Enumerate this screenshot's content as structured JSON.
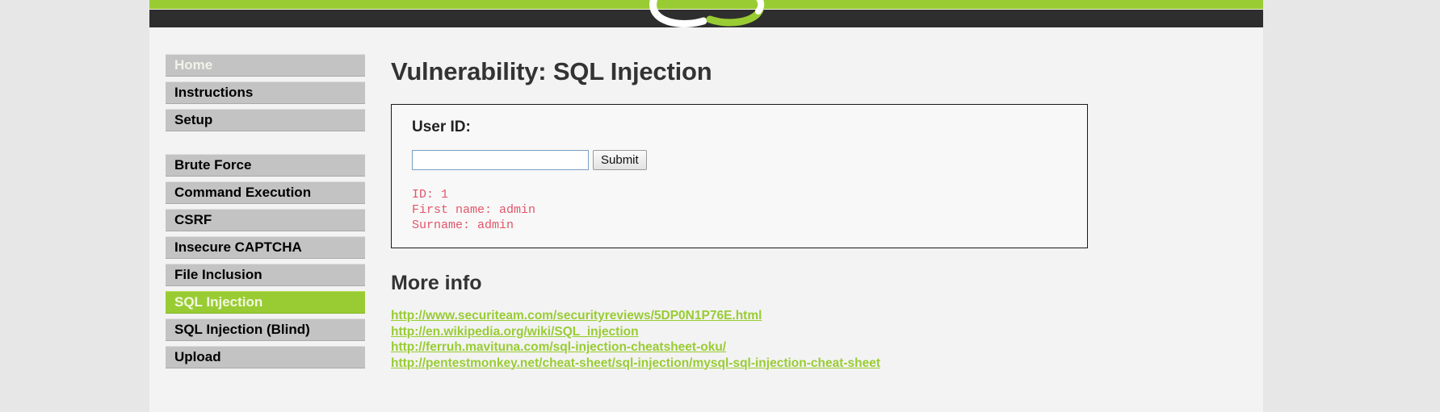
{
  "header": {
    "logo_name": "dvwa-logo",
    "bar_color": "#99cc33",
    "background_color": "#2e2e2e"
  },
  "sidebar": {
    "groups": [
      {
        "items": [
          {
            "label": "Home",
            "state": "dim"
          },
          {
            "label": "Instructions",
            "state": "normal"
          },
          {
            "label": "Setup",
            "state": "normal"
          }
        ]
      },
      {
        "items": [
          {
            "label": "Brute Force",
            "state": "normal"
          },
          {
            "label": "Command Execution",
            "state": "normal"
          },
          {
            "label": "CSRF",
            "state": "normal"
          },
          {
            "label": "Insecure CAPTCHA",
            "state": "normal"
          },
          {
            "label": "File Inclusion",
            "state": "normal"
          },
          {
            "label": "SQL Injection",
            "state": "active"
          },
          {
            "label": "SQL Injection (Blind)",
            "state": "normal"
          },
          {
            "label": "Upload",
            "state": "normal"
          }
        ]
      }
    ]
  },
  "main": {
    "page_title": "Vulnerability: SQL Injection",
    "form": {
      "legend": "User ID:",
      "input_value": "",
      "input_placeholder": "",
      "submit_label": "Submit"
    },
    "result": {
      "lines": [
        "ID: 1",
        "First name: admin",
        "Surname: admin"
      ],
      "text_color": "#e0566a"
    },
    "more_info": {
      "title": "More info",
      "links": [
        "http://www.securiteam.com/securityreviews/5DP0N1P76E.html",
        "http://en.wikipedia.org/wiki/SQL_injection",
        "http://ferruh.mavituna.com/sql-injection-cheatsheet-oku/",
        "http://pentestmonkey.net/cheat-sheet/sql-injection/mysql-sql-injection-cheat-sheet"
      ],
      "link_color": "#99cc33"
    }
  }
}
